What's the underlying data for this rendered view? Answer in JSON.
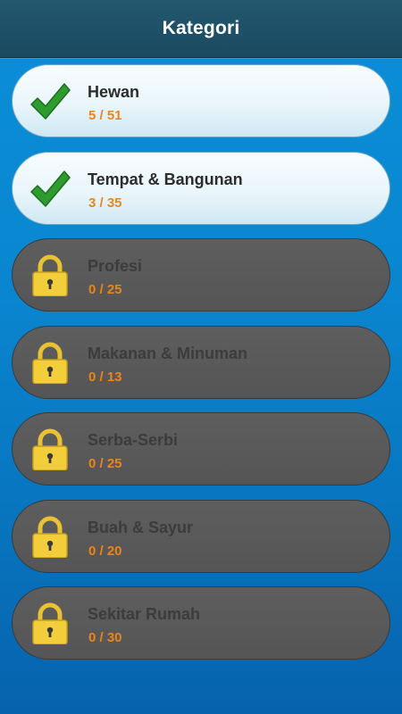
{
  "header": {
    "title": "Kategori"
  },
  "categories": [
    {
      "name": "Hewan",
      "progress": "5 / 51",
      "status": "unlocked",
      "icon": "checkmark-icon"
    },
    {
      "name": "Tempat & Bangunan",
      "progress": "3 / 35",
      "status": "unlocked",
      "icon": "checkmark-icon"
    },
    {
      "name": "Profesi",
      "progress": "0 / 25",
      "status": "locked",
      "icon": "padlock-icon"
    },
    {
      "name": "Makanan & Minuman",
      "progress": "0 / 13",
      "status": "locked",
      "icon": "padlock-icon"
    },
    {
      "name": "Serba-Serbi",
      "progress": "0 / 25",
      "status": "locked",
      "icon": "padlock-icon"
    },
    {
      "name": "Buah & Sayur",
      "progress": "0 / 20",
      "status": "locked",
      "icon": "padlock-icon"
    },
    {
      "name": "Sekitar Rumah",
      "progress": "0 / 30",
      "status": "locked",
      "icon": "padlock-icon"
    }
  ],
  "colors": {
    "header": "#1f5268",
    "background": "#0a86d0",
    "unlocked_card": "#eaf6fb",
    "locked_card": "#585858",
    "progress_text": "#e8861c",
    "check": "#2e9b2e",
    "lock": "#f2cf3a"
  }
}
